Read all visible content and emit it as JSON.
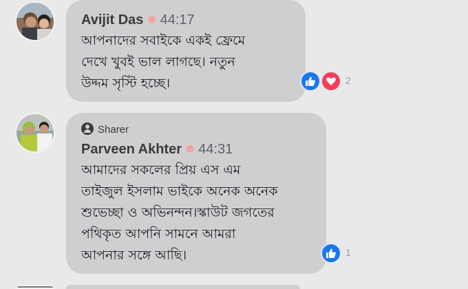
{
  "comments": [
    {
      "author": "Avijit Das",
      "time": "44:17",
      "text": "আপনাদের সবাইকে একই ফ্রেমে\nদেখে খুবই ভাল লাগছে। নতুন\nউদ্দম সৃস্টি  হচ্ছে।",
      "reaction_count": "2",
      "reactions": [
        "like-icon",
        "love-icon"
      ]
    },
    {
      "sharer_label": "Sharer",
      "author": "Parveen Akhter",
      "time": "44:31",
      "text": "আমাদের সকলের প্রিয় এস এম\nতাইজুল ইসলাম ভাইকে অনেক অনেক\nশুভেচ্ছা ও অভিনন্দন।স্কাউট জগতের\nপথিকৃত আপনি সামনে আমরা\nআপনার সঙ্গে আছি।",
      "reaction_count": "1",
      "reactions": [
        "like-icon"
      ]
    }
  ],
  "colors": {
    "background": "#e9e9ea",
    "bubble": "#cfcfd1",
    "like": "#1877f2",
    "love": "#f33e58",
    "separator_dot": "#f3a3a3"
  }
}
